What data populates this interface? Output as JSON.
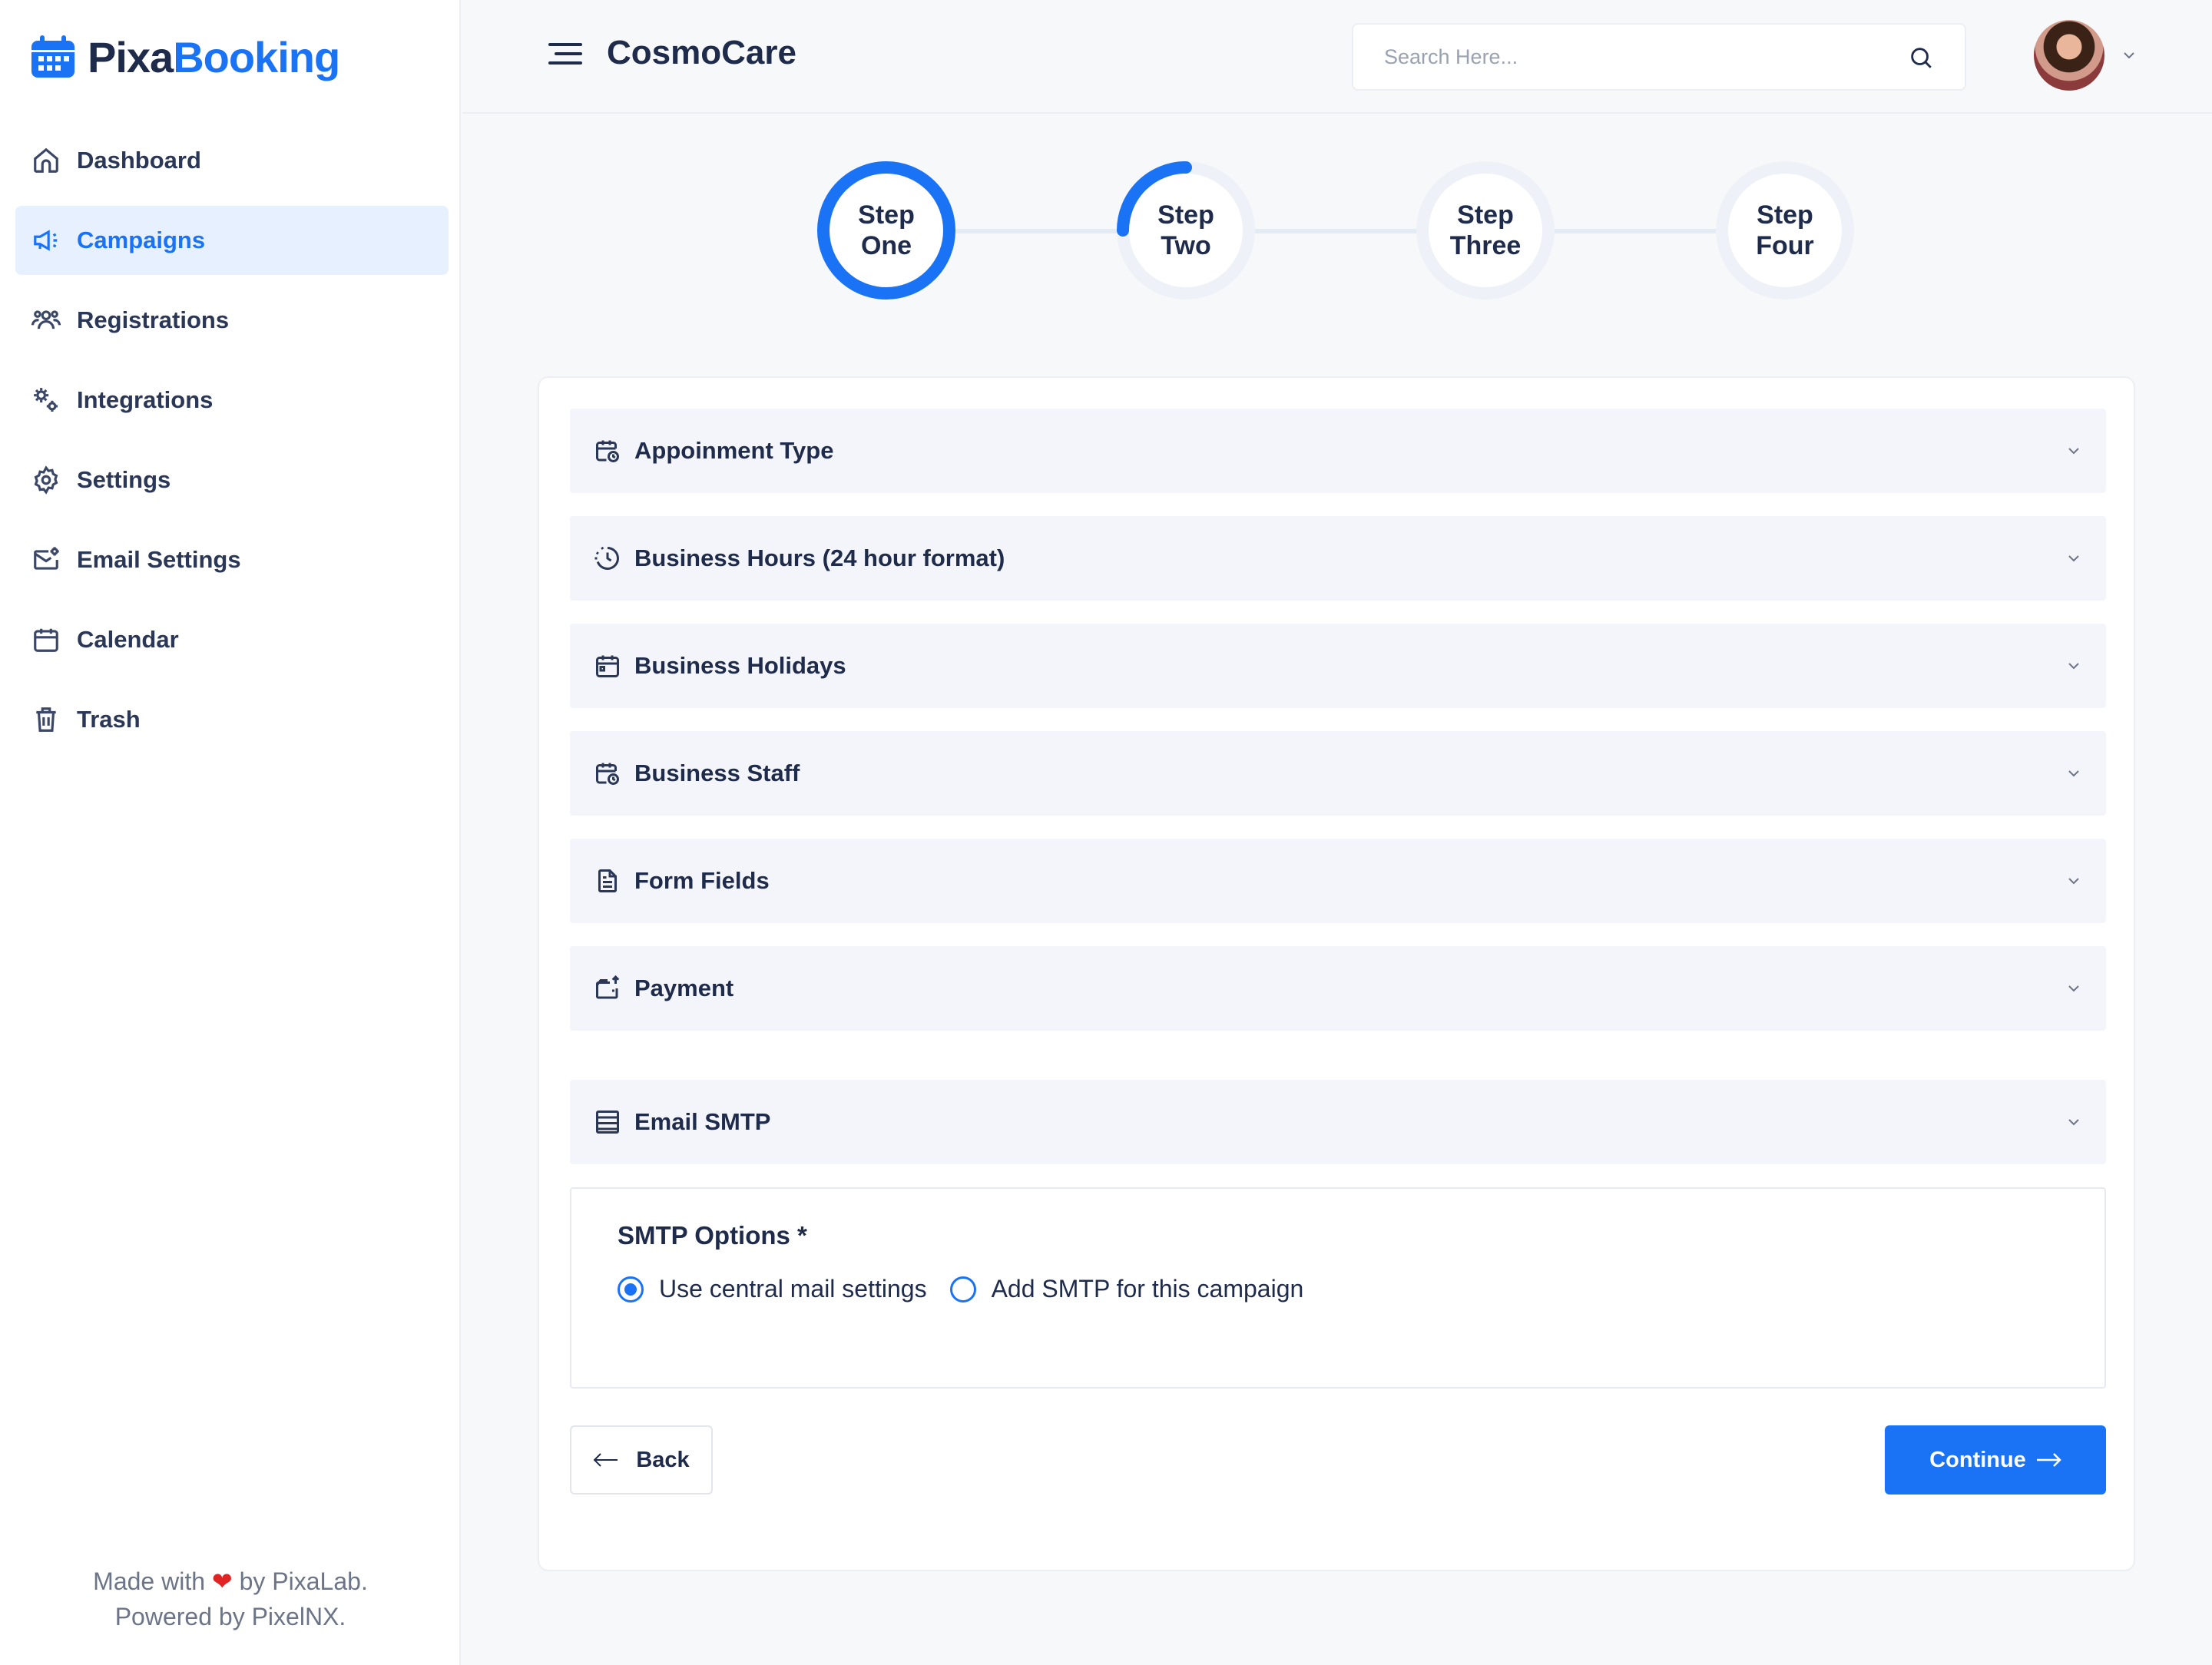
{
  "brand": {
    "logo_part1": "Pixa",
    "logo_part2": "Booking",
    "accent": "#1a73f5"
  },
  "sidebar": {
    "items": [
      {
        "label": "Dashboard",
        "icon": "home-icon",
        "active": false
      },
      {
        "label": "Campaigns",
        "icon": "megaphone-icon",
        "active": true
      },
      {
        "label": "Registrations",
        "icon": "users-icon",
        "active": false
      },
      {
        "label": "Integrations",
        "icon": "gears-icon",
        "active": false
      },
      {
        "label": "Settings",
        "icon": "gear-icon",
        "active": false
      },
      {
        "label": "Email Settings",
        "icon": "mail-gear-icon",
        "active": false
      },
      {
        "label": "Calendar",
        "icon": "calendar-icon",
        "active": false
      },
      {
        "label": "Trash",
        "icon": "trash-icon",
        "active": false
      }
    ],
    "footer_line1_a": "Made with",
    "footer_line1_b": "by PixaLab.",
    "footer_line2": "Powered by PixelNX."
  },
  "header": {
    "title": "CosmoCare",
    "search_placeholder": "Search Here..."
  },
  "steps": [
    {
      "line1": "Step",
      "line2": "One",
      "state": "complete"
    },
    {
      "line1": "Step",
      "line2": "Two",
      "state": "in-progress"
    },
    {
      "line1": "Step",
      "line2": "Three",
      "state": "pending"
    },
    {
      "line1": "Step",
      "line2": "Four",
      "state": "pending"
    }
  ],
  "accordions": [
    {
      "label": "Appoinment Type",
      "icon": "calendar-clock-icon"
    },
    {
      "label": "Business Hours (24 hour format)",
      "icon": "history-clock-icon"
    },
    {
      "label": "Business Holidays",
      "icon": "calendar-icon"
    },
    {
      "label": "Business Staff",
      "icon": "calendar-clock-icon"
    },
    {
      "label": "Form Fields",
      "icon": "document-icon"
    },
    {
      "label": "Payment",
      "icon": "wallet-icon"
    },
    {
      "label": "Email SMTP",
      "icon": "server-icon"
    }
  ],
  "smtp": {
    "title": "SMTP Options *",
    "options": [
      {
        "label": "Use central mail settings",
        "selected": true
      },
      {
        "label": "Add SMTP for this campaign",
        "selected": false
      }
    ]
  },
  "actions": {
    "back_label": "Back",
    "continue_label": "Continue"
  }
}
